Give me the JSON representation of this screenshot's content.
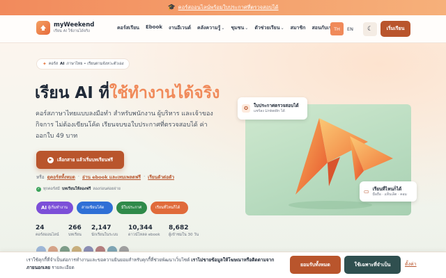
{
  "announcement": {
    "text": "คอร์สออนไลน์พร้อมใบประกาศที่ตรวจสอบได้",
    "icon": "graduation-cap-icon"
  },
  "header": {
    "logo_name": "myWeekend",
    "logo_tagline": "เรียน AI ใช้งานได้จริง",
    "nav": [
      "คอร์สเรียน",
      "Ebook",
      "งานอีเวนต์",
      "คลังความรู้",
      "ชุมชน",
      "ตัวช่วยเรียน",
      "สมาชิก",
      "สอนกับเรา"
    ],
    "nav_dropdown_flags": [
      false,
      false,
      false,
      true,
      true,
      true,
      false,
      false
    ],
    "lang_th": "TH",
    "lang_en": "EN",
    "start_button": "เริ่มเรียน"
  },
  "hero": {
    "pill_label": "คอร์ส",
    "pill_bold": "AI",
    "pill_rest": "ภาษาไทย • เรียนตามจังหวะตัวเอง",
    "title_plain": "เรียน AI ที่",
    "title_accent": "ใช้ทำงานได้จริง",
    "description": "คอร์สภาษาไทยแบบลงมือทำ สำหรับพนักงาน ผู้บริหาร และเจ้าของกิจการ ไม่ต้องเขียนโค้ด เรียนจบขอใบประกาศที่ตรวจสอบได้ ค่าออกใบ 49 บาท",
    "cta": "เลือกสาย แล้วเริ่มบทเรียนฟรี",
    "or_label": "หรือ",
    "link_all_courses": "ดูคอร์สทั้งหมด",
    "link_ebook": "อ่าน ebook และเทมเพลตฟรี",
    "link_samples": "เรียนตัวต่อตัว",
    "link_separator": "·",
    "free_prefix": "ทุกคอร์สมี",
    "free_bold": "บทเรียนให้ลองฟรี",
    "free_suffix": "ลองก่อนค่อยจ่าย",
    "chips": [
      {
        "bold": "AI",
        "label": "ผู้เริ่มทำงาน",
        "color": "#7c4fd8"
      },
      {
        "bold": "",
        "label": "สายเขียนโค้ด",
        "color": "#2f6fd6"
      },
      {
        "bold": "",
        "label": "มีใบประกาศ",
        "color": "#2f8a4a"
      },
      {
        "bold": "",
        "label": "เรียนที่ไหนก็ได้",
        "color": "#e06a3a"
      }
    ],
    "stats": [
      {
        "value": "24",
        "label": "คอร์สออนไลน์"
      },
      {
        "value": "266",
        "label": "บทเรียน"
      },
      {
        "value": "2,147",
        "label": "นักเรียนในระบบ"
      },
      {
        "value": "10,344",
        "label": "ดาวน์โหลด ebook"
      },
      {
        "value": "8,682",
        "label": "ผู้เข้าชมใน 30 วัน"
      }
    ],
    "avatar_colors": [
      "#9fb8d8",
      "#d7a58a",
      "#7f9f8a",
      "#c9b07e",
      "#8c8fb5",
      "#b57f7f",
      "#7fa6b5",
      "#a0a0a0"
    ],
    "badge_certificate": {
      "title": "ใบประกาศตรวจสอบได้",
      "subtitle": "แชร์ลง LinkedIn ได้"
    },
    "badge_anywhere": {
      "title": "เรียนที่ไหนก็ได้",
      "subtitle": "มือถือ · แท็บเล็ต · คอม"
    }
  },
  "cookie": {
    "text_plain": "เราใช้คุกกี้ที่จำเป็นต่อการทำงานและขอความยินยอมสำหรับคุกกี้ที่ช่วยพัฒนาเว็บไซต์ ",
    "text_bold": "เราไม่ขายข้อมูลให้โฆษณาหรือติดตามจากภายนอกเลย",
    "text_suffix": " รายละเอียด",
    "accept_all": "ยอมรับทั้งหมด",
    "necessary_only": "ใช้เฉพาะที่จำเป็น",
    "settings": "ตั้งค่า"
  }
}
